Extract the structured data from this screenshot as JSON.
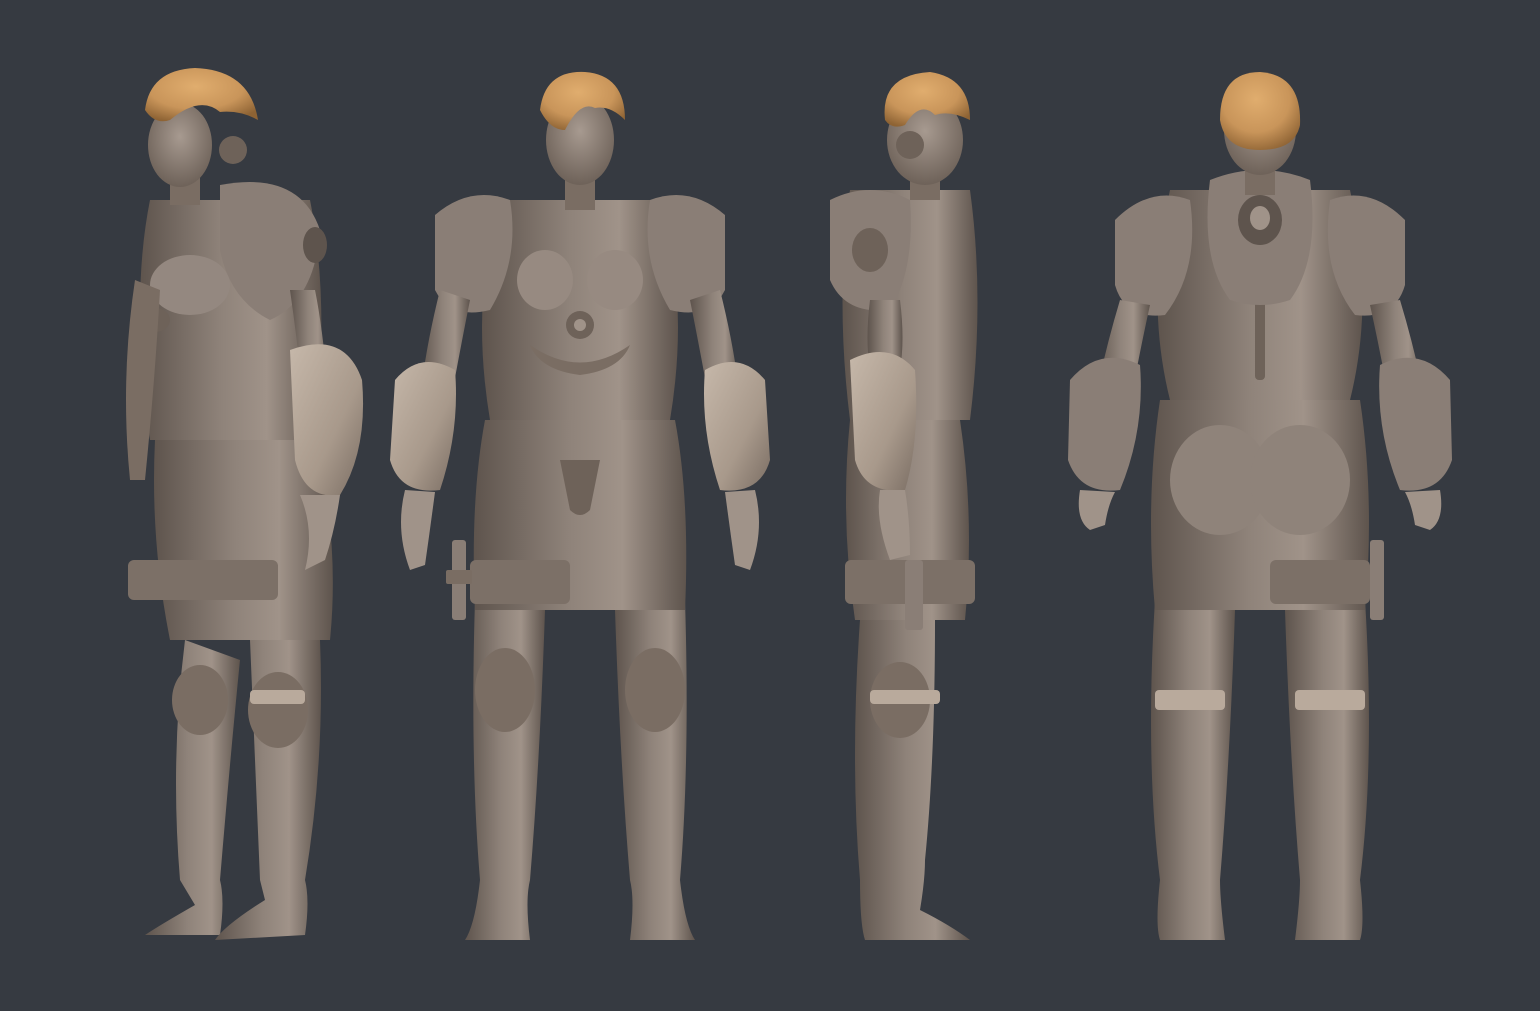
{
  "scene": {
    "background_color": "#363a41",
    "views": [
      {
        "name": "three-quarter-left"
      },
      {
        "name": "front"
      },
      {
        "name": "side-right"
      },
      {
        "name": "back"
      }
    ],
    "colors": {
      "clay": "#8a7e76",
      "clay_shadow": "#5e544d",
      "clay_highlight": "#b3a69c",
      "armor_pale": "#b9aa9c",
      "hair": "#c9955a",
      "hair_shadow": "#8e6334"
    }
  }
}
